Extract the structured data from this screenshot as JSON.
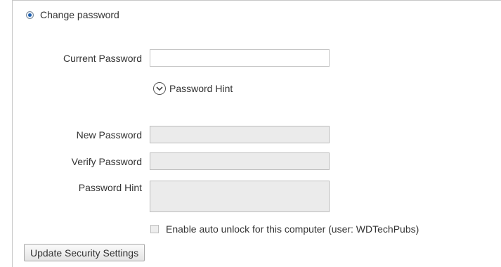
{
  "change_password": {
    "radio_label": "Change password",
    "selected": true
  },
  "form": {
    "current_password_label": "Current Password",
    "current_password_value": "",
    "password_hint_toggle": "Password Hint",
    "new_password_label": "New Password",
    "new_password_value": "",
    "verify_password_label": "Verify Password",
    "verify_password_value": "",
    "password_hint_label": "Password Hint",
    "password_hint_value": ""
  },
  "auto_unlock": {
    "label": "Enable auto unlock for this computer (user: WDTechPubs)",
    "checked": false,
    "disabled": true
  },
  "actions": {
    "update_label": "Update Security Settings"
  },
  "colors": {
    "radio_accent": "#1e5fb0",
    "disabled_field_bg": "#ebebeb"
  }
}
